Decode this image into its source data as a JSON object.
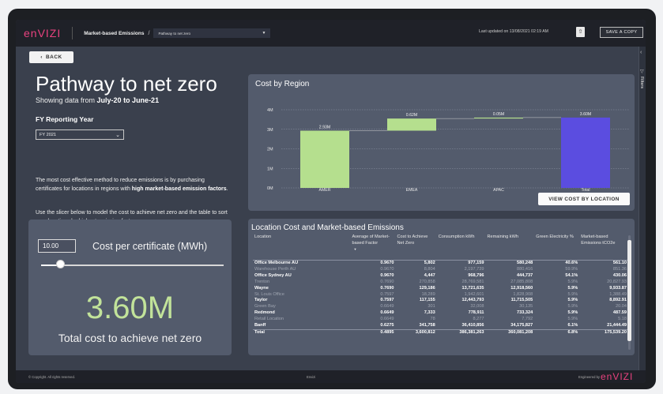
{
  "header": {
    "logo": "enVIZI",
    "breadcrumb": "Market-based Emissions",
    "breadcrumb_sep": "/",
    "page_dropdown": "Pathway to net zero",
    "last_updated": "Last updated on 13/08/2021 02:19 AM",
    "save_label": "SAVE A COPY"
  },
  "rail": {
    "filters_label": "Filters"
  },
  "hero": {
    "back_label": "BACK",
    "title": "Pathway to net zero",
    "subtitle_prefix": "Showing data from ",
    "subtitle_range": "July-20 to June-21",
    "fy_label": "FY Reporting Year",
    "fy_value": "FY 2021",
    "para1_a": "The most cost effective method to reduce emissions is by purchasing certificates for locations in regions with ",
    "para1_b": "high market-based emission factors",
    "para1_c": ".",
    "para2": "Use the slicer below to model the cost to achieve net zero and the table to sort your locations by highest emission factors."
  },
  "cost_panel": {
    "input_value": "10.00",
    "input_label": "Cost per certificate (MWh)",
    "slider_fraction": 0.08,
    "total_value": "3.60M",
    "total_label": "Total cost to achieve net zero"
  },
  "region_panel": {
    "title": "Cost by Region",
    "button_label": "VIEW COST BY LOCATION"
  },
  "chart_data": {
    "type": "waterfall",
    "title": "Cost by Region",
    "y_ticks": [
      "0M",
      "1M",
      "2M",
      "3M",
      "4M"
    ],
    "ylim": [
      0,
      4
    ],
    "categories": [
      "AMER",
      "EMEA",
      "APAC",
      "Total"
    ],
    "deltas": [
      2.93,
      0.62,
      0.05,
      3.6
    ],
    "data_labels": [
      "2.93M",
      "0.62M",
      "0.05M",
      "3.60M"
    ],
    "colors": {
      "increase": "#b5df8e",
      "total": "#5b4de0"
    },
    "grid": true
  },
  "table": {
    "title": "Location Cost and Market-based Emissions",
    "columns": [
      "Location",
      "Average of Market-based Factor",
      "Cost to Achieve Net Zero",
      "Consumption kWh",
      "Remaining kWh",
      "Green Electricity %",
      "Market-based Emissions tCO2e"
    ],
    "rows": [
      {
        "cells": [
          "Office Melbourne AU",
          "0.9670",
          "5,802",
          "977,159",
          "580,248",
          "40.6%",
          "561.10"
        ],
        "style": "bold"
      },
      {
        "cells": [
          "Warehouse Perth AU",
          "0.9670",
          "8,804",
          "2,197,739",
          "880,416",
          "59.9%",
          "851.36"
        ],
        "style": "muted"
      },
      {
        "cells": [
          "Office Sydney AU",
          "0.9670",
          "4,447",
          "968,796",
          "444,737",
          "54.1%",
          "430.06"
        ],
        "style": "bold"
      },
      {
        "cells": [
          "Trenton",
          "0.7690",
          "270,858",
          "28,769,581",
          "27,085,808",
          "5.9%",
          "20,827.93"
        ],
        "style": "muted"
      },
      {
        "cells": [
          "Wayne",
          "0.7690",
          "129,186",
          "13,721,635",
          "12,918,560",
          "5.9%",
          "9,933.87"
        ],
        "style": "bold"
      },
      {
        "cells": [
          "St. Louis Office",
          "0.7597",
          "18,289",
          "1,942,601",
          "1,828,908",
          "5.9%",
          "1,388.49"
        ],
        "style": "muted"
      },
      {
        "cells": [
          "Taylor",
          "0.7597",
          "117,155",
          "12,443,793",
          "11,715,505",
          "5.9%",
          "8,892.91"
        ],
        "style": "bold"
      },
      {
        "cells": [
          "Green Bay",
          "0.6649",
          "301",
          "32,008",
          "30,135",
          "5.9%",
          "20.04"
        ],
        "style": "muted"
      },
      {
        "cells": [
          "Redmond",
          "0.6649",
          "7,333",
          "778,911",
          "733,324",
          "5.9%",
          "487.59"
        ],
        "style": "bold"
      },
      {
        "cells": [
          "Retail Location",
          "0.6649",
          "78",
          "8,277",
          "7,792",
          "5.9%",
          "5.18"
        ],
        "style": "muted"
      },
      {
        "cells": [
          "Banff",
          "0.6275",
          "341,758",
          "36,410,856",
          "34,175,827",
          "6.1%",
          "21,444.49"
        ],
        "style": "bold"
      }
    ],
    "total": [
      "Total",
      "0.4895",
      "3,600,812",
      "386,381,263",
      "360,081,208",
      "6.8%",
      "175,539.20"
    ]
  },
  "footer": {
    "copyright": "© Copyright. All rights reserved.",
    "center": "Envizi",
    "engineered": "Engineered by",
    "logo": "enVIZI"
  }
}
